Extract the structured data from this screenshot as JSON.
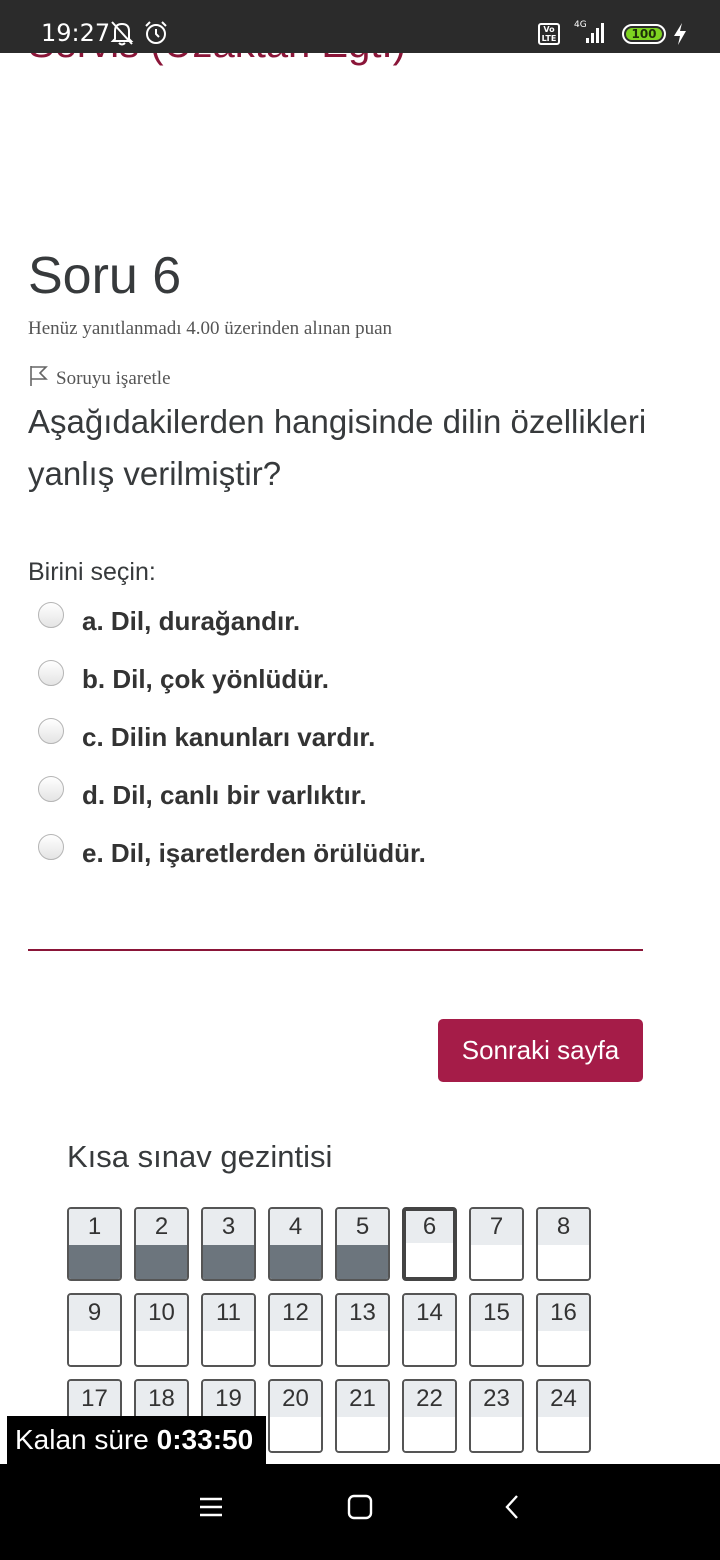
{
  "status_bar": {
    "time": "19:27",
    "volte": "Vo LTE",
    "network": "4G",
    "battery": "100"
  },
  "page": {
    "course_title": "Servis (Uzaktan Egt.)",
    "question_title": "Soru 6",
    "question_status": "Henüz yanıtlanmadı  4.00 üzerinden alınan puan",
    "flag_label": "Soruyu işaretle",
    "question_text": "Aşağıdakilerden hangisinde dilin özellikleri yanlış verilmiştir?",
    "prompt": "Birini seçin:",
    "answers": [
      "a. Dil, durağandır.",
      "b. Dil, çok yönlüdür.",
      "c. Dilin kanunları vardır.",
      "d. Dil, canlı bir varlıktır.",
      "e. Dil, işaretlerden örülüdür."
    ],
    "next_button": "Sonraki sayfa"
  },
  "quiz_nav": {
    "title": "Kısa sınav gezintisi",
    "buttons": [
      {
        "n": "1",
        "state": "answered"
      },
      {
        "n": "2",
        "state": "answered"
      },
      {
        "n": "3",
        "state": "answered"
      },
      {
        "n": "4",
        "state": "answered"
      },
      {
        "n": "5",
        "state": "answered"
      },
      {
        "n": "6",
        "state": "current"
      },
      {
        "n": "7",
        "state": "open"
      },
      {
        "n": "8",
        "state": "open"
      },
      {
        "n": "9",
        "state": "open"
      },
      {
        "n": "10",
        "state": "open"
      },
      {
        "n": "11",
        "state": "open"
      },
      {
        "n": "12",
        "state": "open"
      },
      {
        "n": "13",
        "state": "open"
      },
      {
        "n": "14",
        "state": "open"
      },
      {
        "n": "15",
        "state": "open"
      },
      {
        "n": "16",
        "state": "open"
      },
      {
        "n": "17",
        "state": "open"
      },
      {
        "n": "18",
        "state": "open"
      },
      {
        "n": "19",
        "state": "open"
      },
      {
        "n": "20",
        "state": "open"
      },
      {
        "n": "21",
        "state": "open"
      },
      {
        "n": "22",
        "state": "open"
      },
      {
        "n": "23",
        "state": "open"
      },
      {
        "n": "24",
        "state": "open"
      }
    ]
  },
  "timer": {
    "label": "Kalan süre",
    "value": "0:33:50"
  },
  "colors": {
    "brand": "#a51c48",
    "divider": "#8a1538",
    "answered": "#6c757d",
    "battery": "#7ed321"
  }
}
